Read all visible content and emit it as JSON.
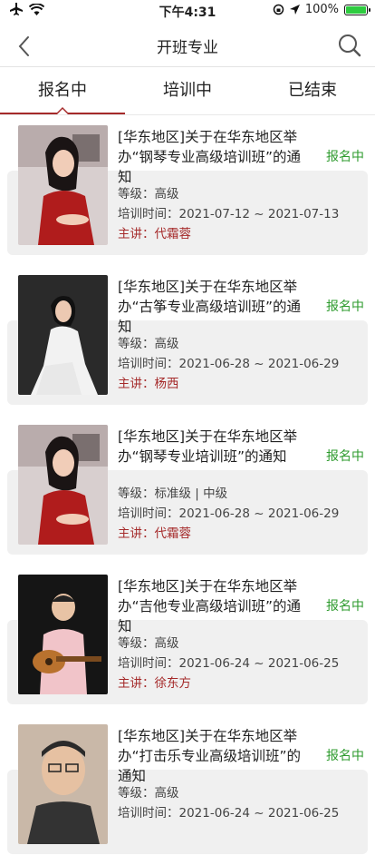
{
  "status_bar": {
    "time": "下午4:31",
    "battery": "100%"
  },
  "nav": {
    "title": "开班专业"
  },
  "tabs": [
    {
      "label": "报名中"
    },
    {
      "label": "培训中"
    },
    {
      "label": "已结束"
    }
  ],
  "meta_labels": {
    "level": "等级：",
    "time": "培训时间：",
    "lecturer": "主讲："
  },
  "items": [
    {
      "title": "[华东地区]关于在华东地区举办“钢琴专业高级培训班”的通知",
      "status": "报名中",
      "level": "高级",
      "time": "2021-07-12 ~ 2021-07-13",
      "lecturer": "代霜蓉"
    },
    {
      "title": "[华东地区]关于在华东地区举办“古筝专业高级培训班”的通知",
      "status": "报名中",
      "level": "高级",
      "time": "2021-06-28 ~ 2021-06-29",
      "lecturer": "杨西"
    },
    {
      "title": "[华东地区]关于在华东地区举办“钢琴专业培训班”的通知",
      "status": "报名中",
      "level": "标准级 | 中级",
      "time": "2021-06-28 ~ 2021-06-29",
      "lecturer": "代霜蓉"
    },
    {
      "title": "[华东地区]关于在华东地区举办“吉他专业高级培训班”的通知",
      "status": "报名中",
      "level": "高级",
      "time": "2021-06-24 ~ 2021-06-25",
      "lecturer": "徐东方"
    },
    {
      "title": "[华东地区]关于在华东地区举办“打击乐专业高级培训班”的通知",
      "status": "报名中",
      "level": "高级",
      "time": "2021-06-24 ~ 2021-06-25",
      "lecturer": ""
    }
  ]
}
